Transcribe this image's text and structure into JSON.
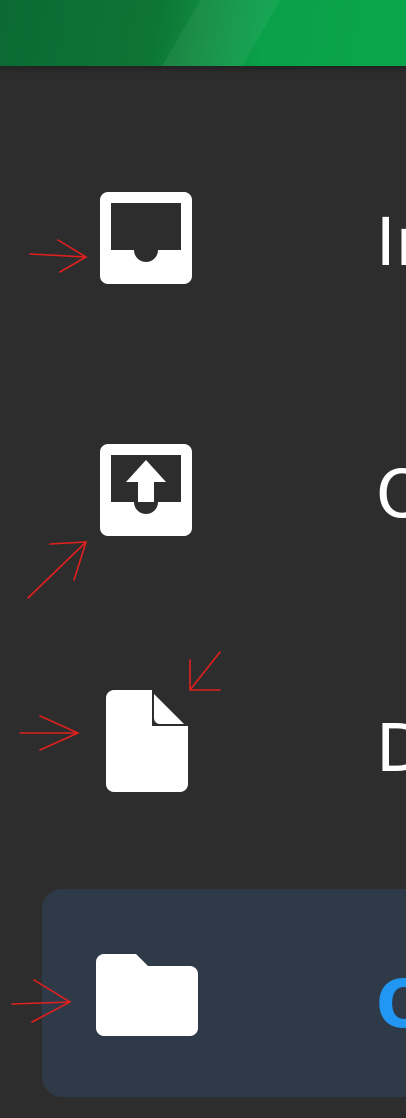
{
  "nav": {
    "items": [
      {
        "label": "Inbox",
        "icon": "inbox-icon"
      },
      {
        "label": "Outbox",
        "icon": "outbox-icon"
      },
      {
        "label": "Drafts",
        "icon": "draft-document-icon"
      },
      {
        "label": "Other",
        "icon": "folder-icon",
        "active": true
      }
    ]
  },
  "colors": {
    "header_green": "#0aa54b",
    "background": "#2d2d2d",
    "active_background": "#2e3a47",
    "active_label": "#2196f3",
    "annotation_red": "#e0201e"
  }
}
